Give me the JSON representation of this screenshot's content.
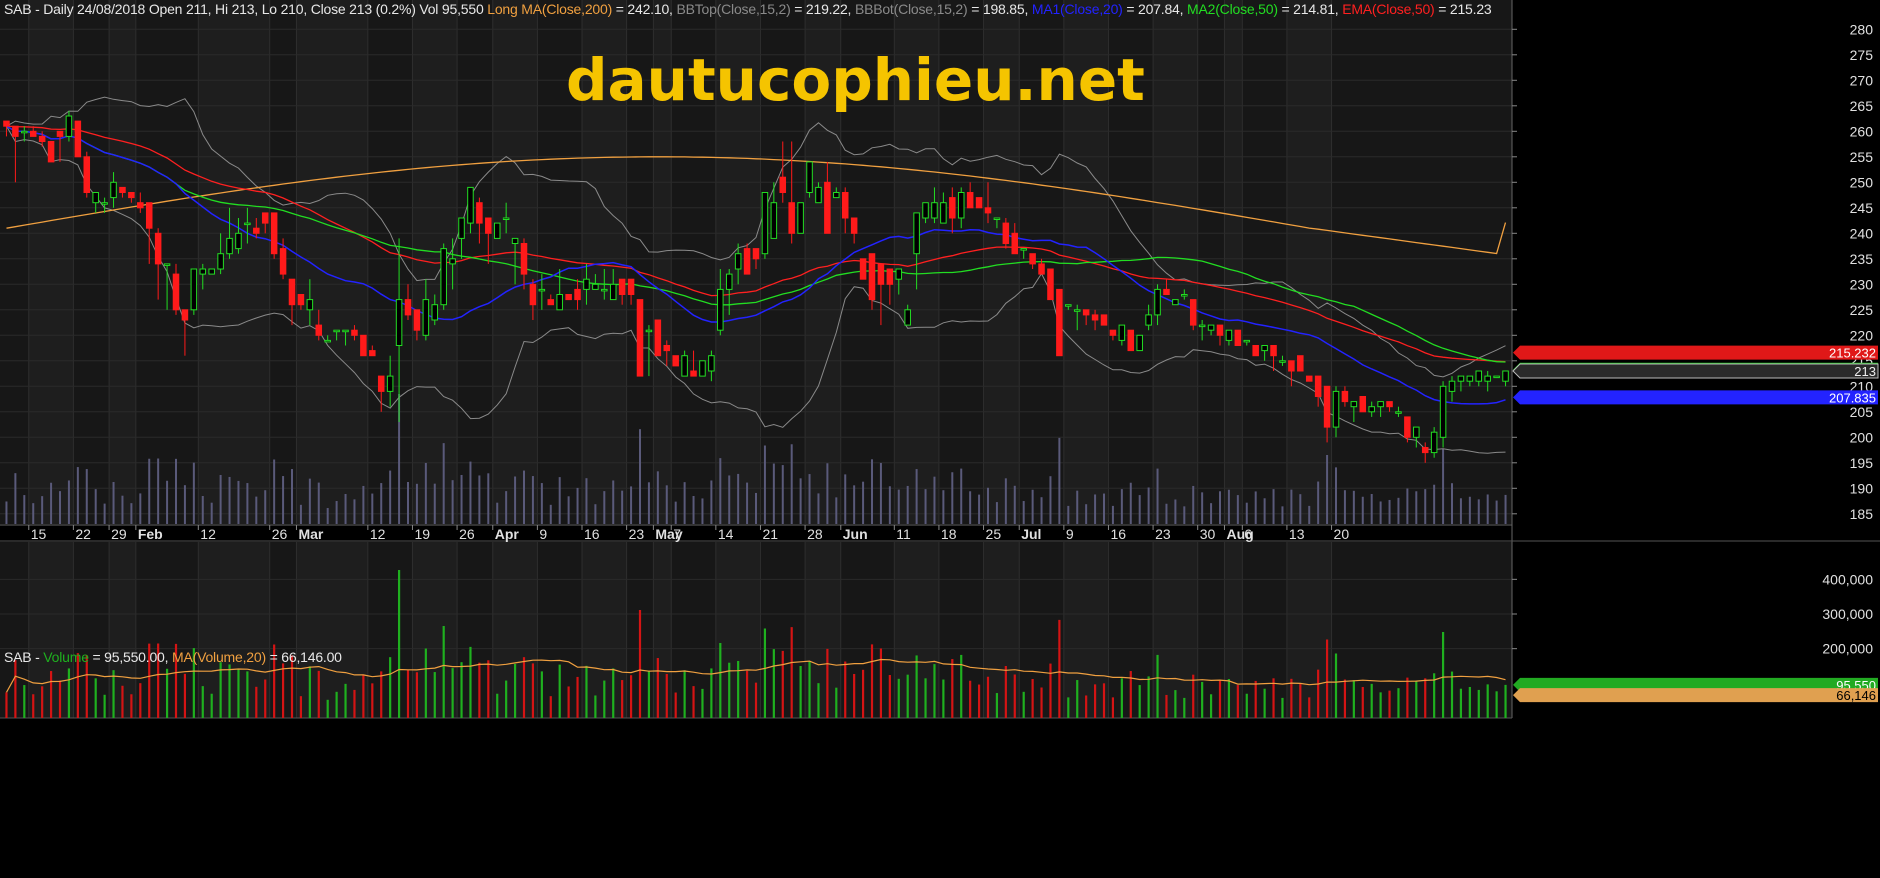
{
  "price_header": {
    "symbol_line": "SAB - Daily 24/08/2018 Open 211, Hi 213, Lo 210, Close 213 (0.2%) Vol 95,550",
    "ma200_label": "Long MA(Close,200)",
    "ma200_value": "= 242.10,",
    "bbtop_label": "BBTop(Close,15,2)",
    "bbtop_value": "= 219.22,",
    "bbbot_label": "BBBot(Close,15,2)",
    "bbbot_value": "= 198.85,",
    "ma1_label": "MA1(Close,20)",
    "ma1_value": "= 207.84,",
    "ma2_label": "MA2(Close,50)",
    "ma2_value": "= 214.81,",
    "ema_label": "EMA(Close,50)",
    "ema_value": "= 215.23"
  },
  "volume_header": {
    "prefix": "SAB -",
    "vol_label": "Volume",
    "vol_value": "= 95,550.00,",
    "ma_label": "MA(Volume,20)",
    "ma_value": "= 66,146.00"
  },
  "watermark": "dautucophieu.net",
  "colors": {
    "up": "#22dd22",
    "down": "#ff1a1a",
    "ma200": "#f0a040",
    "bb": "#8a8a8a",
    "ma1": "#2323ff",
    "ma2": "#22dd22",
    "ema": "#ff2020",
    "volma": "#f0a040",
    "volbg": "#5a5a7a"
  },
  "chart_data": [
    {
      "type": "candlestick",
      "title": "SAB - Daily",
      "y_ticks": [
        185,
        190,
        195,
        200,
        205,
        210,
        215,
        220,
        225,
        230,
        235,
        240,
        245,
        250,
        255,
        260,
        265,
        270,
        275,
        280
      ],
      "ylim": [
        183,
        283
      ],
      "x_ticks": [
        {
          "label": "15",
          "bold": false
        },
        {
          "label": "22",
          "bold": false
        },
        {
          "label": "29",
          "bold": false
        },
        {
          "label": "Feb",
          "bold": true
        },
        {
          "label": "12",
          "bold": false
        },
        {
          "label": "26",
          "bold": false
        },
        {
          "label": "Mar",
          "bold": true
        },
        {
          "label": "12",
          "bold": false
        },
        {
          "label": "19",
          "bold": false
        },
        {
          "label": "26",
          "bold": false
        },
        {
          "label": "Apr",
          "bold": true
        },
        {
          "label": "9",
          "bold": false
        },
        {
          "label": "16",
          "bold": false
        },
        {
          "label": "23",
          "bold": false
        },
        {
          "label": "May",
          "bold": true
        },
        {
          "label": "7",
          "bold": false
        },
        {
          "label": "14",
          "bold": false
        },
        {
          "label": "21",
          "bold": false
        },
        {
          "label": "28",
          "bold": false
        },
        {
          "label": "Jun",
          "bold": true
        },
        {
          "label": "11",
          "bold": false
        },
        {
          "label": "18",
          "bold": false
        },
        {
          "label": "25",
          "bold": false
        },
        {
          "label": "Jul",
          "bold": true
        },
        {
          "label": "9",
          "bold": false
        },
        {
          "label": "16",
          "bold": false
        },
        {
          "label": "23",
          "bold": false
        },
        {
          "label": "30",
          "bold": false
        },
        {
          "label": "Aug",
          "bold": true
        },
        {
          "label": "6",
          "bold": false
        },
        {
          "label": "13",
          "bold": false
        },
        {
          "label": "20",
          "bold": false
        }
      ],
      "x_tick_bar_index": [
        3,
        8,
        12,
        15,
        22,
        30,
        33,
        41,
        46,
        51,
        55,
        60,
        65,
        70,
        73,
        75,
        80,
        85,
        90,
        94,
        100,
        105,
        110,
        114,
        119,
        124,
        129,
        134,
        137,
        139,
        144,
        149
      ],
      "candles": [
        [
          262,
          262,
          259,
          261
        ],
        [
          261,
          261,
          250,
          259
        ],
        [
          260,
          261,
          258,
          260
        ],
        [
          260,
          261,
          259,
          259
        ],
        [
          259,
          260,
          257,
          258
        ],
        [
          258,
          258,
          254,
          254
        ],
        [
          260,
          260,
          254,
          259
        ],
        [
          259,
          264,
          258,
          263
        ],
        [
          262,
          262,
          255,
          255
        ],
        [
          255,
          256,
          247,
          248
        ],
        [
          246,
          248,
          244,
          248
        ],
        [
          246,
          247,
          244,
          246
        ],
        [
          247,
          252,
          245,
          250
        ],
        [
          249,
          249,
          247,
          248
        ],
        [
          248,
          248,
          246,
          247
        ],
        [
          246,
          248,
          244,
          245
        ],
        [
          246,
          246,
          234,
          241
        ],
        [
          240,
          241,
          227,
          234
        ],
        [
          234,
          234,
          225,
          234
        ],
        [
          232,
          234,
          224,
          225
        ],
        [
          225,
          223,
          216,
          223
        ],
        [
          225,
          233,
          224,
          233
        ],
        [
          232,
          234,
          229,
          233
        ],
        [
          232,
          233,
          232,
          233
        ],
        [
          233,
          240,
          232,
          236
        ],
        [
          236,
          245,
          235,
          239
        ],
        [
          237,
          243,
          236,
          240
        ],
        [
          242,
          245,
          238,
          242
        ],
        [
          241,
          243,
          239,
          240
        ],
        [
          244,
          244,
          240,
          242
        ],
        [
          244,
          244,
          235,
          236
        ],
        [
          237,
          239,
          231,
          232
        ],
        [
          231,
          231,
          222,
          226
        ],
        [
          228,
          226,
          225,
          226
        ],
        [
          225,
          231,
          222,
          227
        ],
        [
          222,
          225,
          219,
          220
        ],
        [
          219,
          220,
          219,
          219
        ],
        [
          221,
          221,
          219,
          221
        ],
        [
          221,
          221,
          218,
          221
        ],
        [
          221,
          222,
          219,
          220
        ],
        [
          220,
          220,
          216,
          216
        ],
        [
          217,
          218,
          216,
          216
        ],
        [
          212,
          212,
          205,
          209
        ],
        [
          209,
          216,
          206,
          212
        ],
        [
          218,
          239,
          203,
          227
        ],
        [
          227,
          230,
          223,
          224
        ],
        [
          225,
          223,
          219,
          221
        ],
        [
          220,
          231,
          219,
          227
        ],
        [
          223,
          228,
          222,
          226
        ],
        [
          226,
          238,
          225,
          237
        ],
        [
          234,
          239,
          229,
          235
        ],
        [
          239,
          243,
          235,
          243
        ],
        [
          242,
          249,
          240,
          249
        ],
        [
          246,
          247,
          238,
          242
        ],
        [
          243,
          243,
          234,
          240
        ],
        [
          239,
          240,
          240,
          242
        ],
        [
          243,
          246,
          240,
          243
        ],
        [
          238,
          239,
          230,
          239
        ],
        [
          238,
          239,
          229,
          232
        ],
        [
          230,
          231,
          223,
          226
        ],
        [
          229,
          232,
          225,
          229
        ],
        [
          227,
          228,
          228,
          226
        ],
        [
          225,
          233,
          225,
          228
        ],
        [
          228,
          228,
          228,
          227
        ],
        [
          229,
          231,
          225,
          227
        ],
        [
          229,
          234,
          226,
          231
        ],
        [
          229,
          232,
          230,
          230
        ],
        [
          229,
          233,
          227,
          229
        ],
        [
          227,
          233,
          227,
          230
        ],
        [
          231,
          231,
          226,
          228
        ],
        [
          231,
          231,
          226,
          228
        ],
        [
          227,
          227,
          212,
          212
        ],
        [
          221,
          222,
          212,
          221
        ],
        [
          223,
          223,
          216,
          216
        ],
        [
          218,
          219,
          214,
          217
        ],
        [
          216,
          216,
          217,
          214
        ],
        [
          212,
          217,
          212,
          216
        ],
        [
          213,
          217,
          212,
          212
        ],
        [
          212,
          212,
          216,
          215
        ],
        [
          213,
          217,
          211,
          216
        ],
        [
          221,
          233,
          220,
          229
        ],
        [
          229,
          233,
          224,
          232
        ],
        [
          233,
          238,
          230,
          236
        ],
        [
          237,
          238,
          232,
          232
        ],
        [
          237,
          236,
          233,
          235
        ],
        [
          236,
          246,
          235,
          248
        ],
        [
          239,
          250,
          239,
          246
        ],
        [
          251,
          258,
          246,
          248
        ],
        [
          246,
          258,
          238,
          240
        ],
        [
          240,
          246,
          240,
          246
        ],
        [
          248,
          253,
          247,
          254
        ],
        [
          246,
          250,
          246,
          249
        ],
        [
          250,
          254,
          246,
          240
        ],
        [
          247,
          249,
          249,
          248
        ],
        [
          248,
          249,
          240,
          243
        ],
        [
          243,
          243,
          238,
          240
        ],
        [
          235,
          235,
          231,
          231
        ],
        [
          236,
          236,
          225,
          227
        ],
        [
          234,
          234,
          222,
          230
        ],
        [
          233,
          233,
          226,
          230
        ],
        [
          231,
          233,
          228,
          233
        ],
        [
          222,
          226,
          222,
          225
        ],
        [
          236,
          238,
          229,
          244
        ],
        [
          243,
          246,
          242,
          246
        ],
        [
          243,
          249,
          242,
          246
        ],
        [
          242,
          248,
          244,
          246
        ],
        [
          247,
          249,
          240,
          243
        ],
        [
          243,
          249,
          241,
          248
        ],
        [
          248,
          250,
          246,
          245
        ],
        [
          247,
          247,
          245,
          245
        ],
        [
          245,
          250,
          242,
          244
        ],
        [
          243,
          243,
          241,
          243
        ],
        [
          242,
          243,
          237,
          238
        ],
        [
          240,
          242,
          236,
          236
        ],
        [
          237,
          237,
          235,
          237
        ],
        [
          236,
          236,
          233,
          234
        ],
        [
          234,
          235,
          232,
          232
        ],
        [
          233,
          233,
          227,
          227
        ],
        [
          229,
          229,
          216,
          216
        ],
        [
          226,
          226,
          225,
          226
        ],
        [
          225,
          226,
          221,
          225
        ],
        [
          225,
          224,
          222,
          224
        ],
        [
          224,
          225,
          221,
          223
        ],
        [
          224,
          224,
          222,
          222
        ],
        [
          221,
          220,
          219,
          220
        ],
        [
          219,
          222,
          218,
          222
        ],
        [
          221,
          221,
          217,
          217
        ],
        [
          217,
          220,
          217,
          220
        ],
        [
          222,
          226,
          221,
          224
        ],
        [
          224,
          230,
          222,
          229
        ],
        [
          229,
          231,
          230,
          228
        ],
        [
          226,
          227,
          226,
          227
        ],
        [
          228,
          229,
          227,
          228
        ],
        [
          227,
          225,
          221,
          222
        ],
        [
          222,
          223,
          219,
          222
        ],
        [
          221,
          222,
          220,
          222
        ],
        [
          222,
          222,
          218,
          220
        ],
        [
          219,
          221,
          218,
          221
        ],
        [
          221,
          221,
          218,
          218
        ],
        [
          219,
          218,
          218,
          219
        ],
        [
          218,
          218,
          216,
          216
        ],
        [
          217,
          218,
          215,
          218
        ],
        [
          218,
          217,
          213,
          216
        ],
        [
          215,
          216,
          214,
          215
        ],
        [
          215,
          215,
          210,
          213
        ],
        [
          216,
          214,
          214,
          213
        ],
        [
          212,
          212,
          212,
          211
        ],
        [
          212,
          212,
          206,
          208
        ],
        [
          210,
          210,
          199,
          202
        ],
        [
          202,
          210,
          200,
          209
        ],
        [
          209,
          210,
          206,
          207
        ],
        [
          206,
          206,
          203,
          207
        ],
        [
          208,
          207,
          205,
          205
        ],
        [
          205,
          207,
          204,
          206
        ],
        [
          206,
          207,
          204,
          207
        ],
        [
          207,
          207,
          205,
          206
        ],
        [
          205,
          206,
          204,
          205
        ],
        [
          204,
          204,
          199,
          200
        ],
        [
          200,
          202,
          198,
          202
        ],
        [
          198,
          199,
          195,
          197
        ],
        [
          197,
          202,
          196,
          201
        ],
        [
          200,
          211,
          198,
          210
        ],
        [
          209,
          212,
          207,
          211
        ],
        [
          211,
          212,
          209,
          212
        ],
        [
          211,
          212,
          210,
          212
        ],
        [
          211,
          213,
          210,
          213
        ],
        [
          211,
          213,
          209,
          212
        ],
        [
          212,
          212,
          212,
          212
        ],
        [
          211,
          213,
          210,
          213
        ]
      ],
      "series_badges": [
        {
          "label": "215.232",
          "value": 215.232,
          "color": "#e01818"
        },
        {
          "label": "214.808",
          "value": 214.808,
          "color": "#22cc22"
        },
        {
          "label": "213",
          "value": 213,
          "color": "#a8a8a8"
        },
        {
          "label": "207.835",
          "value": 207.835,
          "color": "#2323ff"
        }
      ]
    },
    {
      "type": "bar",
      "title": "SAB - Volume",
      "y_ticks": [
        200000,
        300000,
        400000
      ],
      "y_tick_labels": [
        "200,000",
        "300,000",
        "400,000"
      ],
      "ylim": [
        0,
        450000
      ],
      "badges": [
        {
          "label": "95,550",
          "value": 95550,
          "color": "#22aa22"
        },
        {
          "label": "66,146",
          "value": 66146,
          "color": "#e0a050"
        }
      ]
    }
  ]
}
